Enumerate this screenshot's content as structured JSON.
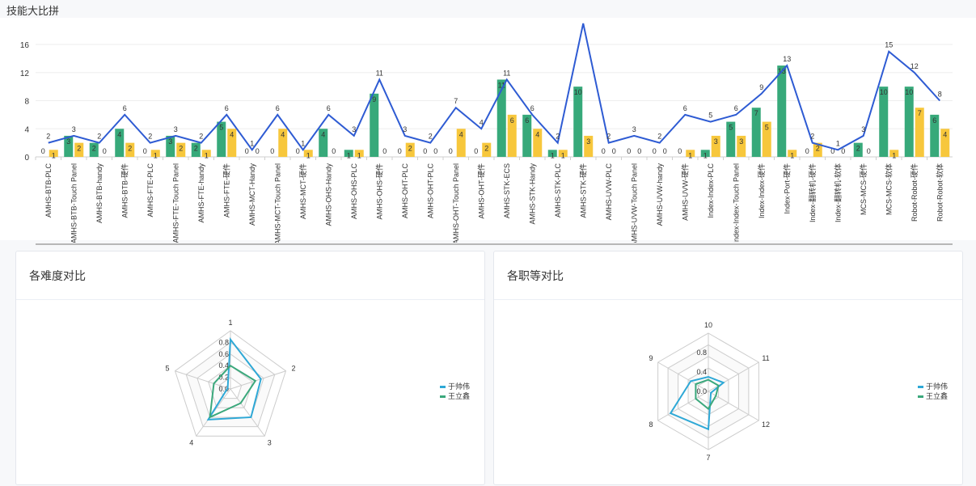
{
  "top": {
    "title": "技能大比拼"
  },
  "panels": {
    "difficulty_title": "各难度对比",
    "grade_title": "各职等对比"
  },
  "chart_data": [
    {
      "type": "bar",
      "ylim": [
        0,
        16
      ],
      "yticks": [
        0,
        4,
        8,
        12,
        16
      ],
      "categories": [
        "AMHS-BTB-PLC",
        "AMHS-BTB-Touch Panel",
        "AMHS-BTB-handy",
        "AMHS-BTB-硬件",
        "AMHS-FTE-PLC",
        "AMHS-FTE-Touch Panel",
        "AMHS-FTE-handy",
        "AMHS-FTE-硬件",
        "AMHS-MCT-Handy",
        "AMHS-MCT-Touch Panel",
        "AMHS-MCT-硬件",
        "AMHS-OHS-Handy",
        "AMHS-OHS-PLC",
        "AMHS-OHS-硬件",
        "AMHS-OHT-PLC",
        "AMHS-OHT-PLC",
        "AMHS-OHT-Touch Panel",
        "AMHS-OHT-硬件",
        "AMHS-STK-ECS",
        "AMHS-STK-Handy",
        "AMHS-STK-PLC",
        "AMHS-STK-硬件",
        "AMHS-UVW-PLC",
        "AMHS-UVW-Touch Panel",
        "AMHS-UVW-handy",
        "AMHS-UVW-硬件",
        "Index-Index-PLC",
        "Index-Index-Touch Panel",
        "Index-Index-硬件",
        "Index-Port-硬件",
        "Index-翻转机-硬件",
        "Index-翻转机-软体",
        "MCS-MCS-硬件",
        "MCS-MCS-软体",
        "Robot-Robot-硬件",
        "Robot-Robot-软体"
      ],
      "series": [
        {
          "values": [
            0,
            3,
            2,
            4,
            0,
            3,
            2,
            5,
            0,
            0,
            0,
            4,
            1,
            9,
            0,
            0,
            0,
            0,
            11,
            6,
            1,
            10,
            0,
            0,
            0,
            0,
            1,
            5,
            7,
            13,
            0,
            0,
            2,
            10,
            10,
            6
          ],
          "color": "#37a97a"
        },
        {
          "values": [
            1,
            2,
            0,
            2,
            1,
            2,
            1,
            4,
            0,
            4,
            1,
            0,
            1,
            0,
            2,
            0,
            4,
            2,
            6,
            4,
            1,
            3,
            0,
            0,
            0,
            1,
            3,
            3,
            5,
            1,
            2,
            0,
            0,
            1,
            7,
            4
          ],
          "color": "#f7c73c"
        },
        {
          "values": [
            2,
            3,
            2,
            6,
            2,
            3,
            2,
            6,
            1,
            6,
            1,
            6,
            3,
            11,
            3,
            2,
            7,
            4,
            11,
            6,
            2,
            19,
            2,
            3,
            2,
            6,
            5,
            6,
            9,
            13,
            2,
            1,
            3,
            15,
            12,
            8
          ],
          "color": "#2e5bd3"
        }
      ],
      "hidden_labels": [
        [
          "line",
          21
        ]
      ]
    },
    {
      "type": "radar",
      "indicators": [
        "1",
        "2",
        "3",
        "4",
        "5"
      ],
      "ticks": [
        "0.0",
        "0.2",
        "0.4",
        "0.6",
        "0.8"
      ],
      "max": 1,
      "series": [
        {
          "name": "于帅伟",
          "values": [
            0.85,
            0.55,
            0.6,
            0.65,
            0.05
          ],
          "color": "#2ea8d6"
        },
        {
          "name": "王立鑫",
          "values": [
            0.4,
            0.45,
            0.3,
            0.6,
            0.3
          ],
          "color": "#3ba87c"
        }
      ]
    },
    {
      "type": "radar",
      "indicators": [
        "10",
        "11",
        "12",
        "7",
        "8",
        "9"
      ],
      "ticks": [
        "0.0",
        "0.4",
        "0.8"
      ],
      "max": 1,
      "series": [
        {
          "name": "于帅伟",
          "values": [
            0.25,
            0.3,
            0.05,
            0.65,
            0.75,
            0.35
          ],
          "color": "#2ea8d6"
        },
        {
          "name": "王立鑫",
          "values": [
            0.2,
            0.2,
            0.15,
            0.3,
            0.25,
            0.25
          ],
          "color": "#3ba87c"
        }
      ]
    }
  ]
}
